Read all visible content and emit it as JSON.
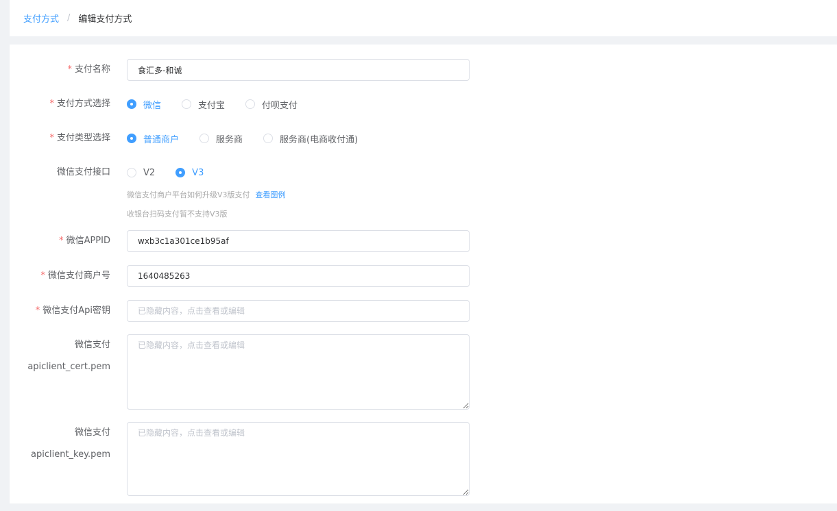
{
  "breadcrumb": {
    "parent": "支付方式",
    "separator": "/",
    "current": "编辑支付方式"
  },
  "form": {
    "pay_name": {
      "label": "支付名称",
      "value": "食汇多-和诚"
    },
    "pay_method": {
      "label": "支付方式选择",
      "options": [
        "微信",
        "支付宝",
        "付呗支付"
      ],
      "selected": "微信"
    },
    "pay_type": {
      "label": "支付类型选择",
      "options": [
        "普通商户",
        "服务商",
        "服务商(电商收付通)"
      ],
      "selected": "普通商户"
    },
    "wx_api": {
      "label": "微信支付接口",
      "options": [
        "V2",
        "V3"
      ],
      "selected": "V3",
      "hint1": "微信支付商户平台如何升级V3版支付",
      "hint1_link": "查看图例",
      "hint2": "收银台扫码支付暂不支持V3版"
    },
    "appid": {
      "label": "微信APPID",
      "value": "wxb3c1a301ce1b95af"
    },
    "mch_id": {
      "label": "微信支付商户号",
      "value": "1640485263"
    },
    "api_key": {
      "label": "微信支付Api密钥",
      "placeholder": "已隐藏内容，点击查看或编辑"
    },
    "cert": {
      "label_line1": "微信支付",
      "label_line2": "apiclient_cert.pem",
      "placeholder": "已隐藏内容，点击查看或编辑"
    },
    "key": {
      "label_line1": "微信支付",
      "label_line2": "apiclient_key.pem",
      "placeholder": "已隐藏内容，点击查看或编辑"
    },
    "required_mark": "*"
  },
  "colors": {
    "accent": "#409eff",
    "required": "#f56c6c",
    "border": "#dcdfe6"
  }
}
